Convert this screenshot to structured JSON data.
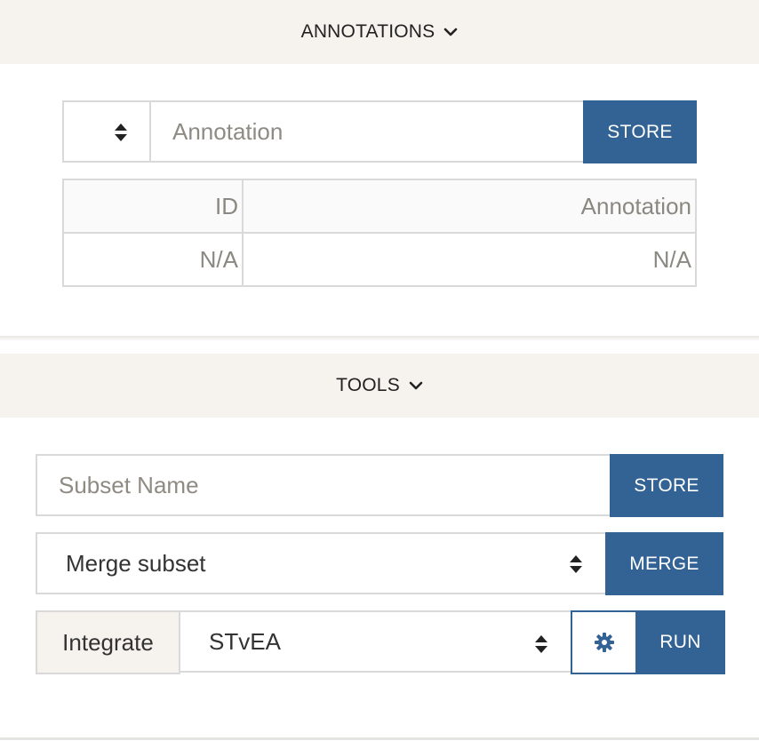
{
  "annotations": {
    "header_label": "ANNOTATIONS",
    "input_placeholder": "Annotation",
    "store_label": "STORE",
    "table": {
      "columns": [
        "ID",
        "Annotation"
      ],
      "rows": [
        [
          "N/A",
          "N/A"
        ]
      ]
    }
  },
  "tools": {
    "header_label": "TOOLS",
    "subset_placeholder": "Subset Name",
    "store_label": "STORE",
    "merge_select_value": "Merge subset",
    "merge_label": "MERGE",
    "integrate_label": "Integrate",
    "integrate_select_value": "STvEA",
    "run_label": "RUN"
  },
  "colors": {
    "accent": "#336294",
    "header_bg": "#f6f3ee",
    "border": "#d9d9d9",
    "placeholder": "#8e8b82"
  },
  "icons": {
    "chevron": "chevron-down-icon",
    "select_arrows": "sort-updown-icon",
    "settings": "gear-icon"
  }
}
